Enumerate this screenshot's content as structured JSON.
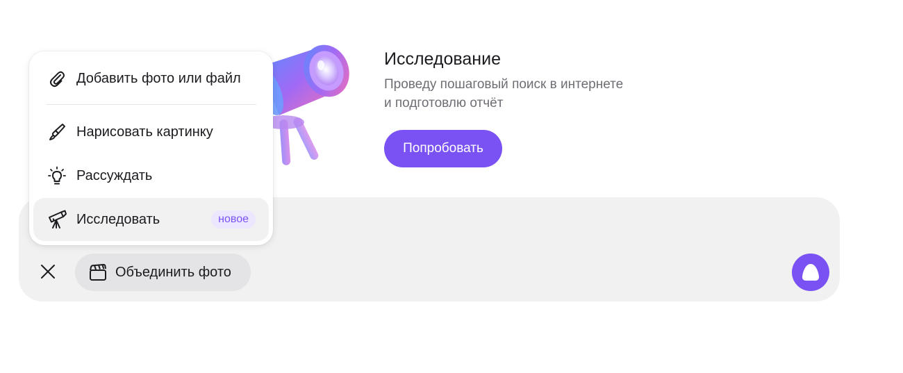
{
  "promo": {
    "title": "Исследование",
    "description_line1": "Проведу пошаговый поиск в интернете",
    "description_line2": "и подготовлю отчёт",
    "button_label": "Попробовать"
  },
  "menu": {
    "items": [
      {
        "label": "Добавить фото или файл",
        "icon": "paperclip-icon"
      },
      {
        "label": "Нарисовать картинку",
        "icon": "paintbrush-icon"
      },
      {
        "label": "Рассуждать",
        "icon": "lightbulb-icon"
      },
      {
        "label": "Исследовать",
        "icon": "telescope-icon",
        "badge": "новое",
        "active": true
      }
    ]
  },
  "composer": {
    "close_icon": "close-icon",
    "mode_chip_label": "Объединить фото",
    "mode_chip_icon": "clapperboard-icon",
    "assistant_icon": "alice-icon"
  },
  "colors": {
    "accent": "#7a52f4",
    "panel": "#f1f1f2",
    "chip": "#e4e4e6",
    "badge_bg": "#ece7fe",
    "muted_text": "#6d6e74"
  }
}
